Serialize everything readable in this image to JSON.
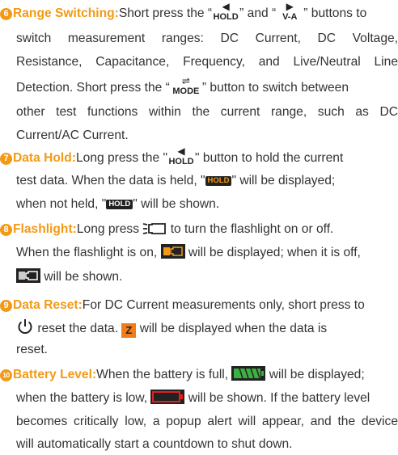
{
  "items": {
    "range": {
      "number": "6",
      "title": "Range Switching:",
      "line1_a": "Short press the",
      "btn_hold_arrow": "◀",
      "btn_hold_label": "HOLD",
      "line1_and": "and",
      "btn_va_arrow": "▶",
      "btn_va_label": "V-A",
      "line1_b": "buttons to",
      "line2": "switch measurement ranges: DC Current, DC Voltage,",
      "line3": "Resistance, Capacitance, Frequency, and Live/Neutral Line",
      "line4_a": "Detection. Short press the",
      "btn_mode_arrow": "⇌",
      "btn_mode_label": "MODE",
      "line4_b": "button to switch between",
      "line5": "other test functions within the current range, such as DC",
      "line6": "Current/AC Current."
    },
    "hold": {
      "number": "7",
      "title": "Data Hold:",
      "line1_a": "Long press the",
      "btn_arrow": "◀",
      "btn_label": "HOLD",
      "line1_b": "button to hold the current",
      "line2_a": "test data. When the data is held,",
      "badge_on": "HOLD",
      "line2_b": "will be displayed;",
      "line3_a": "when not held,",
      "badge_off": "HOLD",
      "line3_b": "will be shown."
    },
    "flashlight": {
      "number": "8",
      "title": "Flashlight:",
      "line1_a": "Long press",
      "line1_b": "to turn the flashlight on or off.",
      "line2_a": "When the flashlight is on,",
      "line2_b": "will be displayed; when it is off,",
      "line3": "will be shown."
    },
    "reset": {
      "number": "9",
      "title": "Data Reset:",
      "line1": "For DC Current measurements only, short press to",
      "line2_a": "reset the data.",
      "badge": "Z",
      "line2_b": "will be displayed when the data is",
      "line3": "reset."
    },
    "battery": {
      "number": "10",
      "title": "Battery Level:",
      "line1_a": "When the battery is full,",
      "line1_b": "will be displayed;",
      "line2_a": "when the battery is low,",
      "line2_b": "will be shown. If the battery level",
      "line3": "becomes critically low, a popup alert will appear, and the device",
      "line4": "will automatically start a countdown to shut down."
    }
  },
  "colors": {
    "accent": "#f29a16",
    "text": "#333333",
    "battery_full": "#3cb043",
    "battery_low": "#e02020"
  }
}
